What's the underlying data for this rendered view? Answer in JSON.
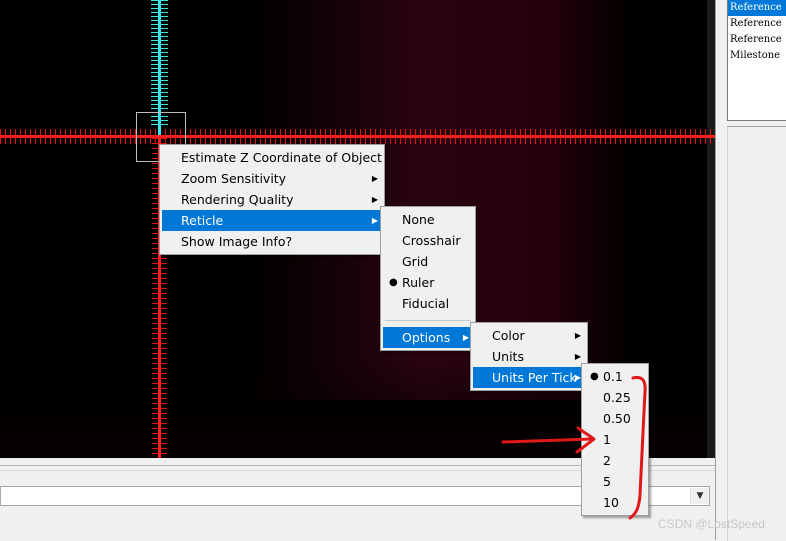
{
  "reference_list": {
    "items": [
      {
        "label": "Reference",
        "selected": true
      },
      {
        "label": "Reference",
        "selected": false
      },
      {
        "label": "Reference",
        "selected": false
      },
      {
        "label": "Milestone",
        "selected": false
      }
    ]
  },
  "context_menu": {
    "items": [
      {
        "label": "Estimate Z Coordinate of Object",
        "submenu": false
      },
      {
        "label": "Zoom Sensitivity",
        "submenu": true
      },
      {
        "label": "Rendering Quality",
        "submenu": true
      },
      {
        "label": "Reticle",
        "submenu": true,
        "highlighted": true
      },
      {
        "label": "Show Image Info?",
        "submenu": false
      }
    ]
  },
  "reticle_menu": {
    "items": [
      {
        "label": "None"
      },
      {
        "label": "Crosshair"
      },
      {
        "label": "Grid"
      },
      {
        "label": "Ruler",
        "checked": true
      },
      {
        "label": "Fiducial"
      }
    ],
    "options_label": "Options"
  },
  "options_menu": {
    "items": [
      {
        "label": "Color"
      },
      {
        "label": "Units"
      },
      {
        "label": "Units Per Tick",
        "highlighted": true
      }
    ]
  },
  "units_per_tick_menu": {
    "items": [
      {
        "label": "0.1",
        "checked": true
      },
      {
        "label": "0.25"
      },
      {
        "label": "0.50"
      },
      {
        "label": "1"
      },
      {
        "label": "2"
      },
      {
        "label": "5"
      },
      {
        "label": "10"
      }
    ]
  },
  "icons": {
    "submenu_arrow": "▶",
    "radio_bullet": "●",
    "dropdown_arrow": "▼"
  },
  "watermark": "CSDN @LostSpeed",
  "colors": {
    "ruler_red": "#ff1e1e",
    "ruler_cyan": "#35e8ea",
    "highlight": "#0078d7",
    "annotation": "#e01818"
  }
}
